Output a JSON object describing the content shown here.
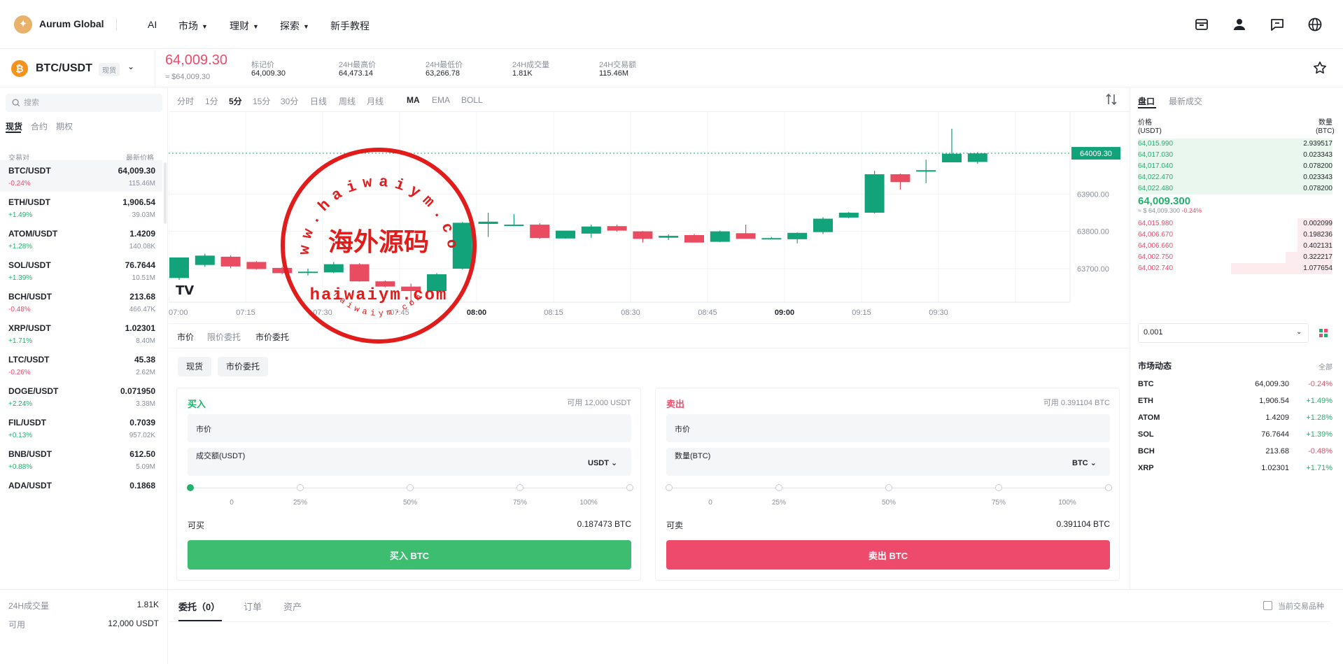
{
  "header": {
    "brand": "Aurum Global",
    "logo_glyph": "✦",
    "nav": [
      {
        "label": "AI",
        "has_dropdown": false
      },
      {
        "label": "市场",
        "has_dropdown": true
      },
      {
        "label": "理财",
        "has_dropdown": true
      },
      {
        "label": "探索",
        "has_dropdown": true
      },
      {
        "label": "新手教程",
        "has_dropdown": false
      }
    ],
    "right_icons": [
      "wallet-icon",
      "user-icon",
      "message-icon",
      "globe-icon"
    ]
  },
  "ticker": {
    "pair": "BTC/USDT",
    "badge": "现货",
    "coin_glyph": "₿",
    "last_price": "64,009.30",
    "last_price_sub": "≈ $64,009.30",
    "stats": [
      {
        "label": "标记价",
        "value": "64,009.30",
        "tone": "normal"
      },
      {
        "label": "24H最高价",
        "value": "64,473.14",
        "tone": "green"
      },
      {
        "label": "24H最低价",
        "value": "63,266.78",
        "tone": "red"
      },
      {
        "label": "24H成交量",
        "value": "1.81K",
        "tone": "normal"
      },
      {
        "label": "24H交易额",
        "value": "115.46M",
        "tone": "normal"
      }
    ]
  },
  "market_list": {
    "search_placeholder": "搜索",
    "tabs": [
      "现货",
      "合约",
      "期权"
    ],
    "col_pair": "交易对",
    "col_price": "最新价格",
    "rows": [
      {
        "pair": "BTC/USDT",
        "price": "64,009.30",
        "change": "-0.24%",
        "volume": "115.46M",
        "up": false
      },
      {
        "pair": "ETH/USDT",
        "price": "1,906.54",
        "change": "+1.49%",
        "volume": "39.03M",
        "up": true
      },
      {
        "pair": "ATOM/USDT",
        "price": "1.4209",
        "change": "+1.28%",
        "volume": "140.08K",
        "up": true
      },
      {
        "pair": "SOL/USDT",
        "price": "76.7644",
        "change": "+1.39%",
        "volume": "10.51M",
        "up": true
      },
      {
        "pair": "BCH/USDT",
        "price": "213.68",
        "change": "-0.48%",
        "volume": "466.47K",
        "up": false
      },
      {
        "pair": "XRP/USDT",
        "price": "1.02301",
        "change": "+1.71%",
        "volume": "8.40M",
        "up": true
      },
      {
        "pair": "LTC/USDT",
        "price": "45.38",
        "change": "-0.26%",
        "volume": "2.62M",
        "up": false
      },
      {
        "pair": "DOGE/USDT",
        "price": "0.071950",
        "change": "+2.24%",
        "volume": "3.38M",
        "up": true
      },
      {
        "pair": "FIL/USDT",
        "price": "0.7039",
        "change": "+0.13%",
        "volume": "957.02K",
        "up": true
      },
      {
        "pair": "BNB/USDT",
        "price": "612.50",
        "change": "+0.88%",
        "volume": "5.09M",
        "up": true
      },
      {
        "pair": "ADA/USDT",
        "price": "0.1868",
        "change": "",
        "volume": "",
        "up": true
      }
    ]
  },
  "chart": {
    "timeframes": [
      "分时",
      "1分",
      "5分",
      "15分",
      "30分",
      "日线",
      "周线",
      "月线"
    ],
    "active_timeframe": "5分",
    "indicators": [
      "MA",
      "EMA",
      "BOLL"
    ],
    "active_indicator": "MA",
    "logo_text": "TV"
  },
  "chart_data": {
    "type": "candlestick",
    "x_ticks": [
      "07:00",
      "07:15",
      "07:30",
      "07:45",
      "08:00",
      "08:15",
      "08:30",
      "08:45",
      "09:00",
      "09:15",
      "09:30"
    ],
    "y_ticks": [
      "63900.00",
      "63800.00",
      "63700.00"
    ],
    "ylim": [
      63610,
      64120
    ],
    "last_price_label": "64009.30",
    "last_price": 64009.3,
    "candles": [
      {
        "o": 63675,
        "h": 63693,
        "l": 63670,
        "c": 63730
      },
      {
        "o": 63710,
        "h": 63740,
        "l": 63705,
        "c": 63735
      },
      {
        "o": 63732,
        "h": 63736,
        "l": 63701,
        "c": 63706
      },
      {
        "o": 63718,
        "h": 63720,
        "l": 63698,
        "c": 63699
      },
      {
        "o": 63702,
        "h": 63705,
        "l": 63685,
        "c": 63688
      },
      {
        "o": 63689,
        "h": 63700,
        "l": 63682,
        "c": 63692
      },
      {
        "o": 63690,
        "h": 63718,
        "l": 63688,
        "c": 63712
      },
      {
        "o": 63712,
        "h": 63715,
        "l": 63665,
        "c": 63666
      },
      {
        "o": 63666,
        "h": 63668,
        "l": 63650,
        "c": 63652
      },
      {
        "o": 63652,
        "h": 63660,
        "l": 63600,
        "c": 63640
      },
      {
        "o": 63640,
        "h": 63688,
        "l": 63637,
        "c": 63685
      },
      {
        "o": 63700,
        "h": 63825,
        "l": 63698,
        "c": 63823
      },
      {
        "o": 63820,
        "h": 63850,
        "l": 63785,
        "c": 63826
      },
      {
        "o": 63818,
        "h": 63846,
        "l": 63816,
        "c": 63818
      },
      {
        "o": 63818,
        "h": 63822,
        "l": 63780,
        "c": 63782
      },
      {
        "o": 63781,
        "h": 63802,
        "l": 63780,
        "c": 63802
      },
      {
        "o": 63794,
        "h": 63818,
        "l": 63783,
        "c": 63813
      },
      {
        "o": 63814,
        "h": 63818,
        "l": 63799,
        "c": 63802
      },
      {
        "o": 63800,
        "h": 63801,
        "l": 63770,
        "c": 63780
      },
      {
        "o": 63783,
        "h": 63792,
        "l": 63777,
        "c": 63788
      },
      {
        "o": 63790,
        "h": 63793,
        "l": 63775,
        "c": 63770
      },
      {
        "o": 63772,
        "h": 63802,
        "l": 63771,
        "c": 63800
      },
      {
        "o": 63795,
        "h": 63818,
        "l": 63788,
        "c": 63780
      },
      {
        "o": 63782,
        "h": 63785,
        "l": 63780,
        "c": 63782
      },
      {
        "o": 63779,
        "h": 63797,
        "l": 63768,
        "c": 63796
      },
      {
        "o": 63798,
        "h": 63838,
        "l": 63793,
        "c": 63834
      },
      {
        "o": 63837,
        "h": 63852,
        "l": 63835,
        "c": 63850
      },
      {
        "o": 63850,
        "h": 63962,
        "l": 63848,
        "c": 63953
      },
      {
        "o": 63953,
        "h": 63955,
        "l": 63912,
        "c": 63932
      },
      {
        "o": 63960,
        "h": 63992,
        "l": 63929,
        "c": 63964
      },
      {
        "o": 63985,
        "h": 64075,
        "l": 63985,
        "c": 64008
      },
      {
        "o": 63986,
        "h": 64012,
        "l": 63981,
        "c": 64009
      }
    ]
  },
  "order_tabs": [
    "市价",
    "限价委托",
    "市价委托"
  ],
  "order_pills": [
    "现货",
    "市价委托"
  ],
  "buy": {
    "title": "买入",
    "avail": "可用 12,000 USDT",
    "price_field": "市价",
    "amount_label": "成交额(USDT)",
    "unit": "USDT",
    "slider_labels": [
      "0",
      "25%",
      "50%",
      "75%",
      "100%"
    ],
    "max_label": "可买",
    "max_value": "0.187473 BTC",
    "button": "买入 BTC"
  },
  "sell": {
    "title": "卖出",
    "avail": "可用 0.391104 BTC",
    "price_field": "市价",
    "amount_label": "数量(BTC)",
    "unit": "BTC",
    "slider_labels": [
      "0",
      "25%",
      "50%",
      "75%",
      "100%"
    ],
    "max_label": "可卖",
    "max_value": "0.391104 BTC",
    "button": "卖出 BTC"
  },
  "orderbook": {
    "tabs": [
      "盘口",
      "最新成交"
    ],
    "col_price": "价格\n(USDT)",
    "col_qty": "数量\n(BTC)",
    "bids": [
      {
        "price": "64,015.990",
        "qty": "2.939517",
        "depth": 1.0
      },
      {
        "price": "64,017.030",
        "qty": "0.023343",
        "depth": 1.0
      },
      {
        "price": "64,017.040",
        "qty": "0.078200",
        "depth": 1.0
      },
      {
        "price": "64,022.470",
        "qty": "0.023343",
        "depth": 1.0
      },
      {
        "price": "64,022.480",
        "qty": "0.078200",
        "depth": 1.0
      }
    ],
    "mid": "64,009.300",
    "mid_sub": "≈ $ 64,009.300",
    "mid_change": "-0.24%",
    "asks": [
      {
        "price": "64,015.980",
        "qty": "0.002099",
        "depth": 0.18
      },
      {
        "price": "64,006.670",
        "qty": "0.198236",
        "depth": 0.18
      },
      {
        "price": "64,006.660",
        "qty": "0.402131",
        "depth": 0.18
      },
      {
        "price": "64,002.750",
        "qty": "0.322217",
        "depth": 0.24
      },
      {
        "price": "64,002.740",
        "qty": "1.077654",
        "depth": 0.52
      }
    ],
    "precision": "0.001"
  },
  "market_feed": {
    "title": "市场动态",
    "all_label": "全部",
    "rows": [
      {
        "sym": "BTC",
        "price": "64,009.30",
        "change": "-0.24%",
        "up": false
      },
      {
        "sym": "ETH",
        "price": "1,906.54",
        "change": "+1.49%",
        "up": true
      },
      {
        "sym": "ATOM",
        "price": "1.4209",
        "change": "+1.28%",
        "up": true
      },
      {
        "sym": "SOL",
        "price": "76.7644",
        "change": "+1.39%",
        "up": true
      },
      {
        "sym": "BCH",
        "price": "213.68",
        "change": "-0.48%",
        "up": false
      },
      {
        "sym": "XRP",
        "price": "1.02301",
        "change": "+1.71%",
        "up": true
      }
    ]
  },
  "bottom_left": {
    "vol_label": "24H成交量",
    "vol_value": "1.81K",
    "avail_label": "可用",
    "avail_value": "12,000 USDT"
  },
  "bottom_tabs": [
    "委托（0）",
    "订单",
    "资产"
  ],
  "only_current_label": "当前交易品种",
  "watermark": {
    "arc_top": "www.haiwaiym.com",
    "center": "海外源码",
    "domain": "haiwaiym.com",
    "arc_bottom": "haiwaiym.com"
  },
  "colors": {
    "up": "#20b26c",
    "down": "#ef4a6b",
    "buy_button": "#3dbd70",
    "sell_button": "#ee4a6c"
  }
}
